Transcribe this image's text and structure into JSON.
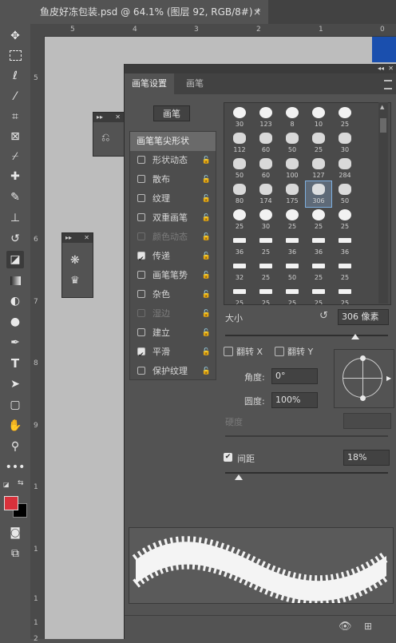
{
  "document": {
    "tab_title": "鱼皮好冻包装.psd @ 64.1% (图层 92, RGB/8#) *",
    "close_glyph": "×"
  },
  "rulers": {
    "top": [
      "5",
      "4",
      "3",
      "2",
      "1",
      "0"
    ],
    "left": [
      "5",
      "6",
      "7",
      "8",
      "9",
      "1",
      "1",
      "1",
      "1",
      "2"
    ]
  },
  "toolbar": {
    "tools": [
      "move-icon",
      "marquee-icon",
      "lasso-icon",
      "magic-wand-icon",
      "crop-icon",
      "frame-icon",
      "eyedropper-icon",
      "healing-brush-icon",
      "brush-icon",
      "clone-stamp-icon",
      "history-brush-icon",
      "eraser-icon",
      "gradient-icon",
      "blur-icon",
      "dodge-icon",
      "pen-icon",
      "type-icon",
      "path-selection-icon",
      "rectangle-icon",
      "hand-icon",
      "zoom-icon",
      "more-tools-icon"
    ],
    "fg_color": "#d8313b",
    "bg_color": "#000000"
  },
  "panel": {
    "tabs": [
      "画笔设置",
      "画笔"
    ],
    "brush_button": "画笔",
    "list_header": "画笔笔尖形状",
    "options": [
      {
        "label": "形状动态",
        "checked": false,
        "enabled": true
      },
      {
        "label": "散布",
        "checked": false,
        "enabled": true
      },
      {
        "label": "纹理",
        "checked": false,
        "enabled": true
      },
      {
        "label": "双重画笔",
        "checked": false,
        "enabled": true
      },
      {
        "label": "颜色动态",
        "checked": false,
        "enabled": false
      },
      {
        "label": "传递",
        "checked": true,
        "enabled": true
      },
      {
        "label": "画笔笔势",
        "checked": false,
        "enabled": true
      },
      {
        "label": "杂色",
        "checked": false,
        "enabled": true
      },
      {
        "label": "湿边",
        "checked": false,
        "enabled": false
      },
      {
        "label": "建立",
        "checked": false,
        "enabled": true
      },
      {
        "label": "平滑",
        "checked": true,
        "enabled": true
      },
      {
        "label": "保护纹理",
        "checked": false,
        "enabled": true
      }
    ],
    "brush_sizes": [
      "30",
      "123",
      "8",
      "10",
      "25",
      "112",
      "60",
      "50",
      "25",
      "30",
      "50",
      "60",
      "100",
      "127",
      "284",
      "80",
      "174",
      "175",
      "306",
      "50",
      "25",
      "30",
      "25",
      "25",
      "25",
      "36",
      "25",
      "36",
      "36",
      "36",
      "32",
      "25",
      "50",
      "25",
      "25",
      "25",
      "25",
      "25",
      "25",
      "25"
    ],
    "selected_brush_index": 18,
    "size_label": "大小",
    "size_value": "306 像素",
    "flip_x": "翻转 X",
    "flip_y": "翻转 Y",
    "angle_label": "角度:",
    "angle_value": "0°",
    "roundness_label": "圆度:",
    "roundness_value": "100%",
    "hardness_label": "硬度",
    "spacing_label": "间距",
    "spacing_value": "18%"
  }
}
